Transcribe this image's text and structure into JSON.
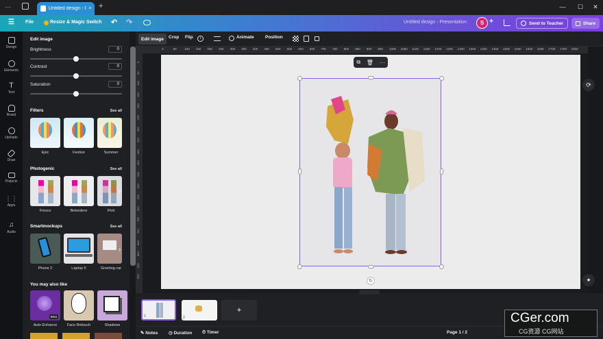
{
  "browser": {
    "tab_title": "Untitled design - P...",
    "new_tab": "+",
    "win_min": "—",
    "win_max": "☐",
    "win_close": "✕"
  },
  "topbar": {
    "menu": "☰",
    "file": "File",
    "resize": "Resize & Magic Switch",
    "doc_title": "Untitled design - Presentation",
    "avatar": "S",
    "send": "Send to Teacher",
    "share": "Share"
  },
  "rail": [
    "Design",
    "Elements",
    "Text",
    "Brand",
    "Uploads",
    "Draw",
    "Projects",
    "Apps",
    "Audio"
  ],
  "panel": {
    "header": "Edit image",
    "sliders": [
      {
        "label": "Brightness",
        "value": "0",
        "level": 0.5
      },
      {
        "label": "Contrast",
        "value": "0",
        "level": 0.5
      },
      {
        "label": "Saturation",
        "value": "0",
        "level": 0.5
      }
    ],
    "filters_title": "Filters",
    "filters": [
      "Epic",
      "Festive",
      "Summer"
    ],
    "photogenic_title": "Photogenic",
    "photogenic": [
      "Fresco",
      "Belvedere",
      "Flint"
    ],
    "smartmockups_title": "Smartmockups",
    "smartmockups": [
      "Phone 2",
      "Laptop 5",
      "Greeting car"
    ],
    "also_like_title": "You may also like",
    "also_like": [
      "Auto Enhance",
      "Face Retouch",
      "Shadows"
    ],
    "beta": "Beta",
    "see_all": "See all"
  },
  "toolbar": {
    "edit_image": "Edit image",
    "crop": "Crop",
    "flip": "Flip",
    "animate": "Animate",
    "position": "Position"
  },
  "ruler_top": [
    "0",
    "50",
    "100",
    "150",
    "200",
    "250",
    "300",
    "350",
    "400",
    "450",
    "500",
    "550",
    "600",
    "650",
    "700",
    "750",
    "800",
    "850",
    "900",
    "950",
    "1000",
    "1050",
    "1100",
    "1150",
    "1200",
    "1250",
    "1300",
    "1350",
    "1400",
    "1450",
    "1500",
    "1550",
    "1600",
    "1650",
    "1700",
    "1750",
    "1800",
    "1850",
    "1900"
  ],
  "ruler_left": [
    "0",
    "50",
    "100",
    "150",
    "200",
    "250",
    "300",
    "350",
    "400",
    "450",
    "500",
    "550",
    "600",
    "650",
    "700",
    "750",
    "800",
    "850",
    "900",
    "950",
    "1000"
  ],
  "footer": {
    "notes": "Notes",
    "duration": "Duration",
    "timer": "Timer",
    "page": "Page 1 / 2"
  },
  "pages": [
    "1",
    "2"
  ],
  "add_page": "+",
  "watermark": {
    "line1": "CGer.com",
    "line2": "CG资源 CG网站"
  },
  "colors": {
    "accent": "#8b5cf6",
    "panel": "#1f2023"
  }
}
